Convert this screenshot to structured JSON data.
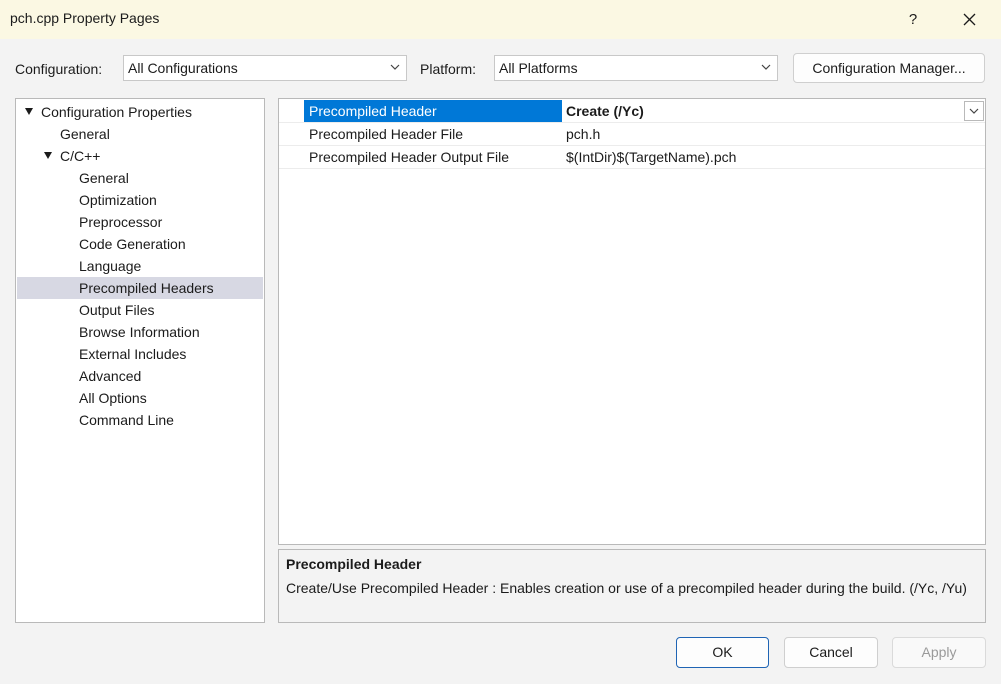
{
  "window": {
    "title": "pch.cpp Property Pages",
    "help_label": "?"
  },
  "toolbar": {
    "configuration_label": "Configuration:",
    "configuration_value": "All Configurations",
    "platform_label": "Platform:",
    "platform_value": "All Platforms",
    "config_manager_label": "Configuration Manager..."
  },
  "tree": {
    "items": [
      {
        "label": "Configuration Properties"
      },
      {
        "label": "General"
      },
      {
        "label": "C/C++"
      },
      {
        "label": "General"
      },
      {
        "label": "Optimization"
      },
      {
        "label": "Preprocessor"
      },
      {
        "label": "Code Generation"
      },
      {
        "label": "Language"
      },
      {
        "label": "Precompiled Headers"
      },
      {
        "label": "Output Files"
      },
      {
        "label": "Browse Information"
      },
      {
        "label": "External Includes"
      },
      {
        "label": "Advanced"
      },
      {
        "label": "All Options"
      },
      {
        "label": "Command Line"
      }
    ],
    "selected": "Precompiled Headers"
  },
  "properties": [
    {
      "name": "Precompiled Header",
      "value": "Create (/Yc)"
    },
    {
      "name": "Precompiled Header File",
      "value": "pch.h"
    },
    {
      "name": "Precompiled Header Output File",
      "value": "$(IntDir)$(TargetName).pch"
    }
  ],
  "description": {
    "title": "Precompiled Header",
    "text": "Create/Use Precompiled Header : Enables creation or use of a precompiled header during the build. (/Yc, /Yu)"
  },
  "buttons": {
    "ok": "OK",
    "cancel": "Cancel",
    "apply": "Apply"
  },
  "colors": {
    "selection_accent": "#0078d7",
    "tree_selection": "#d7d8e3",
    "titlebar": "#fbf8e3"
  }
}
